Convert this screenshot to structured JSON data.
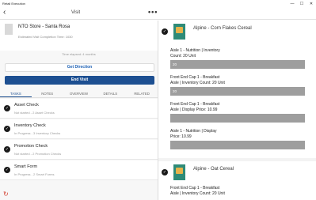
{
  "window": {
    "title": "Retail Execution",
    "minimize": "—",
    "maximize": "☐",
    "close": "✕"
  },
  "navbar": {
    "back": "‹",
    "title": "Visit",
    "more": "•••"
  },
  "store": {
    "name": "NTO Store - Santa Rosa",
    "estimated_time": "Estimated Visit Completion Time: 1030"
  },
  "time_elapsed": "Time elapsed: 4 months",
  "buttons": {
    "get_direction": "Get Direction",
    "end_visit": "End Visit"
  },
  "tabs": [
    {
      "label": "TASKS",
      "active": true
    },
    {
      "label": "NOTES",
      "active": false
    },
    {
      "label": "OVERVIEW",
      "active": false
    },
    {
      "label": "DETAILS",
      "active": false
    },
    {
      "label": "RELATED",
      "active": false
    }
  ],
  "tasks": [
    {
      "title": "Asset Check",
      "subtitle": "Not started - 2 Asset Checks"
    },
    {
      "title": "Inventory Check",
      "subtitle": "In Progress - 3 Inventory Checks"
    },
    {
      "title": "Promotion Check",
      "subtitle": "Not started - 2 Promotion Checks"
    },
    {
      "title": "Smart Form",
      "subtitle": "In Progress - 2 Smart Forms"
    }
  ],
  "products": [
    {
      "name": "Alpine - Corn Flakes Cereal",
      "checks": [
        {
          "label_line1": "Aisle 1 - Nutrition | Inventory",
          "label_line2": "Count: 20 Unit",
          "value": "20"
        },
        {
          "label_line1": "Front End Cap 1 - Breakfast",
          "label_line2": "Aisle | Inventory Count: 20 Unit",
          "value": "20"
        },
        {
          "label_line1": "Front End Cap 1 - Breakfast",
          "label_line2": "Aisle | Display Price: 10.99",
          "value": ""
        },
        {
          "label_line1": "Aisle 1 - Nutrition | Display",
          "label_line2": "Price: 10.99",
          "value": ""
        }
      ]
    },
    {
      "name": "Alpine - Oat Cereal",
      "checks": [
        {
          "label_line1": "Front End Cap 1 - Breakfast",
          "label_line2": "Aisle | Inventory Count: 20 Unit",
          "value": ""
        }
      ]
    }
  ],
  "icons": {
    "check": "✓",
    "refresh": "↻"
  },
  "colors": {
    "accent": "#1d4f91",
    "link": "#1a5fb4",
    "refresh": "#d13a2a"
  }
}
